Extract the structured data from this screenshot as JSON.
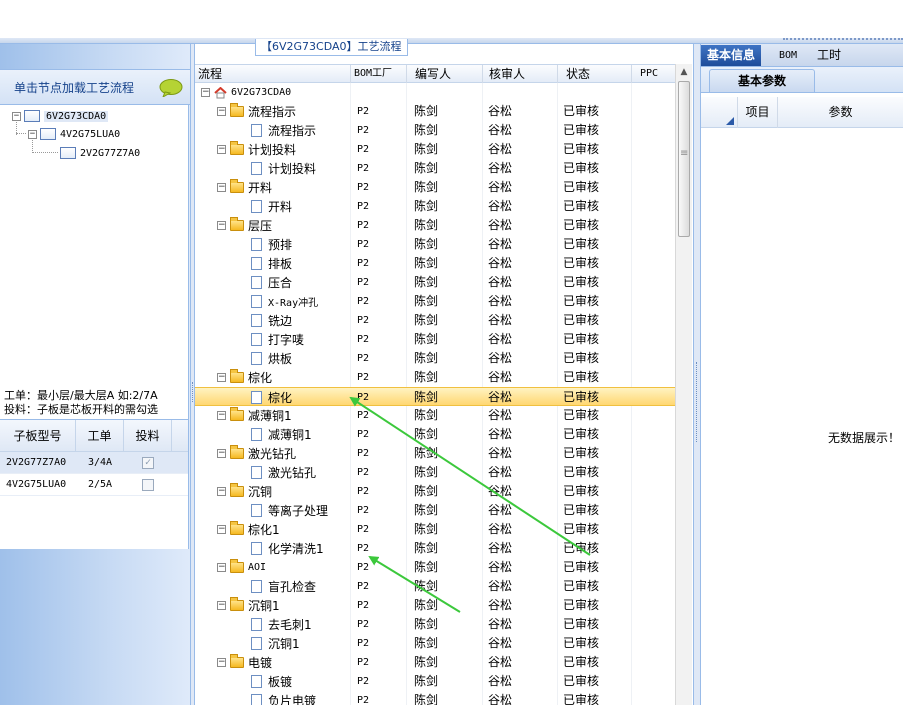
{
  "left": {
    "header_title": "单击节点加载工艺流程",
    "tree": [
      {
        "label": "6V2G73CDA0",
        "level": 0,
        "expand": "−"
      },
      {
        "label": "4V2G75LUA0",
        "level": 1,
        "expand": "−"
      },
      {
        "label": "2V2G77Z7A0",
        "level": 2,
        "expand": ""
      }
    ],
    "note_line1": "工单：最小层/最大层A 如:2/7A",
    "note_line2": "投料：子板是芯板开料的需勾选",
    "sub_grid": {
      "headers": [
        "子板型号",
        "工单",
        "投料"
      ],
      "rows": [
        {
          "model": "2V2G77Z7A0",
          "order": "3/4A",
          "checked": "✓"
        },
        {
          "model": "4V2G75LUA0",
          "order": "2/5A",
          "checked": ""
        }
      ]
    }
  },
  "center": {
    "title": "【6V2G73CDA0】工艺流程",
    "headers": {
      "flow": "流程",
      "bom": "BOM工厂",
      "writer": "编写人",
      "reviewer": "核审人",
      "status": "状态",
      "ppc": "PPC"
    },
    "root": "6V2G73CDA0",
    "rows": [
      {
        "label": "流程指示",
        "kind": "folder",
        "bom": "P2",
        "writer": "陈剑",
        "reviewer": "谷松",
        "status": "已审核"
      },
      {
        "label": "流程指示",
        "kind": "item",
        "bom": "P2",
        "writer": "陈剑",
        "reviewer": "谷松",
        "status": "已审核"
      },
      {
        "label": "计划投料",
        "kind": "folder",
        "bom": "P2",
        "writer": "陈剑",
        "reviewer": "谷松",
        "status": "已审核"
      },
      {
        "label": "计划投料",
        "kind": "item",
        "bom": "P2",
        "writer": "陈剑",
        "reviewer": "谷松",
        "status": "已审核"
      },
      {
        "label": "开料",
        "kind": "folder",
        "bom": "P2",
        "writer": "陈剑",
        "reviewer": "谷松",
        "status": "已审核"
      },
      {
        "label": "开料",
        "kind": "item",
        "bom": "P2",
        "writer": "陈剑",
        "reviewer": "谷松",
        "status": "已审核"
      },
      {
        "label": "层压",
        "kind": "folder",
        "bom": "P2",
        "writer": "陈剑",
        "reviewer": "谷松",
        "status": "已审核"
      },
      {
        "label": "预排",
        "kind": "item",
        "bom": "P2",
        "writer": "陈剑",
        "reviewer": "谷松",
        "status": "已审核"
      },
      {
        "label": "排板",
        "kind": "item",
        "bom": "P2",
        "writer": "陈剑",
        "reviewer": "谷松",
        "status": "已审核"
      },
      {
        "label": "压合",
        "kind": "item",
        "bom": "P2",
        "writer": "陈剑",
        "reviewer": "谷松",
        "status": "已审核"
      },
      {
        "label": "X-Ray冲孔",
        "kind": "item",
        "bom": "P2",
        "writer": "陈剑",
        "reviewer": "谷松",
        "status": "已审核"
      },
      {
        "label": "铣边",
        "kind": "item",
        "bom": "P2",
        "writer": "陈剑",
        "reviewer": "谷松",
        "status": "已审核"
      },
      {
        "label": "打字唛",
        "kind": "item",
        "bom": "P2",
        "writer": "陈剑",
        "reviewer": "谷松",
        "status": "已审核"
      },
      {
        "label": "烘板",
        "kind": "item",
        "bom": "P2",
        "writer": "陈剑",
        "reviewer": "谷松",
        "status": "已审核"
      },
      {
        "label": "棕化",
        "kind": "folder",
        "bom": "P2",
        "writer": "陈剑",
        "reviewer": "谷松",
        "status": "已审核"
      },
      {
        "label": "棕化",
        "kind": "item",
        "bom": "P2",
        "writer": "陈剑",
        "reviewer": "谷松",
        "status": "已审核",
        "selected": true
      },
      {
        "label": "减薄铜1",
        "kind": "folder",
        "bom": "P2",
        "writer": "陈剑",
        "reviewer": "谷松",
        "status": "已审核"
      },
      {
        "label": "减薄铜1",
        "kind": "item",
        "bom": "P2",
        "writer": "陈剑",
        "reviewer": "谷松",
        "status": "已审核"
      },
      {
        "label": "激光钻孔",
        "kind": "folder",
        "bom": "P2",
        "writer": "陈剑",
        "reviewer": "谷松",
        "status": "已审核"
      },
      {
        "label": "激光钻孔",
        "kind": "item",
        "bom": "P2",
        "writer": "陈剑",
        "reviewer": "谷松",
        "status": "已审核"
      },
      {
        "label": "沉铜",
        "kind": "folder",
        "bom": "P2",
        "writer": "陈剑",
        "reviewer": "谷松",
        "status": "已审核"
      },
      {
        "label": "等离子处理",
        "kind": "item",
        "bom": "P2",
        "writer": "陈剑",
        "reviewer": "谷松",
        "status": "已审核"
      },
      {
        "label": "棕化1",
        "kind": "folder",
        "bom": "P2",
        "writer": "陈剑",
        "reviewer": "谷松",
        "status": "已审核"
      },
      {
        "label": "化学清洗1",
        "kind": "item",
        "bom": "P2",
        "writer": "陈剑",
        "reviewer": "谷松",
        "status": "已审核"
      },
      {
        "label": "AOI",
        "kind": "folder",
        "bom": "P2",
        "writer": "陈剑",
        "reviewer": "谷松",
        "status": "已审核"
      },
      {
        "label": "盲孔检查",
        "kind": "item",
        "bom": "P2",
        "writer": "陈剑",
        "reviewer": "谷松",
        "status": "已审核"
      },
      {
        "label": "沉铜1",
        "kind": "folder",
        "bom": "P2",
        "writer": "陈剑",
        "reviewer": "谷松",
        "status": "已审核"
      },
      {
        "label": "去毛刺1",
        "kind": "item",
        "bom": "P2",
        "writer": "陈剑",
        "reviewer": "谷松",
        "status": "已审核"
      },
      {
        "label": "沉铜1",
        "kind": "item",
        "bom": "P2",
        "writer": "陈剑",
        "reviewer": "谷松",
        "status": "已审核"
      },
      {
        "label": "电镀",
        "kind": "folder",
        "bom": "P2",
        "writer": "陈剑",
        "reviewer": "谷松",
        "status": "已审核"
      },
      {
        "label": "板镀",
        "kind": "item",
        "bom": "P2",
        "writer": "陈剑",
        "reviewer": "谷松",
        "status": "已审核"
      },
      {
        "label": "负片电镀",
        "kind": "item",
        "bom": "P2",
        "writer": "陈剑",
        "reviewer": "谷松",
        "status": "已审核"
      }
    ]
  },
  "right": {
    "tabs": [
      "基本信息",
      "BOM",
      "工时"
    ],
    "subtab": "基本参数",
    "headers": {
      "item": "项目",
      "param": "参数"
    },
    "empty_text": "无数据展示！"
  },
  "colors": {
    "accent": "#15428b",
    "border": "#99bbe8",
    "selected_row": "#ffd772",
    "annotation_arrow": "#3cc83c"
  }
}
